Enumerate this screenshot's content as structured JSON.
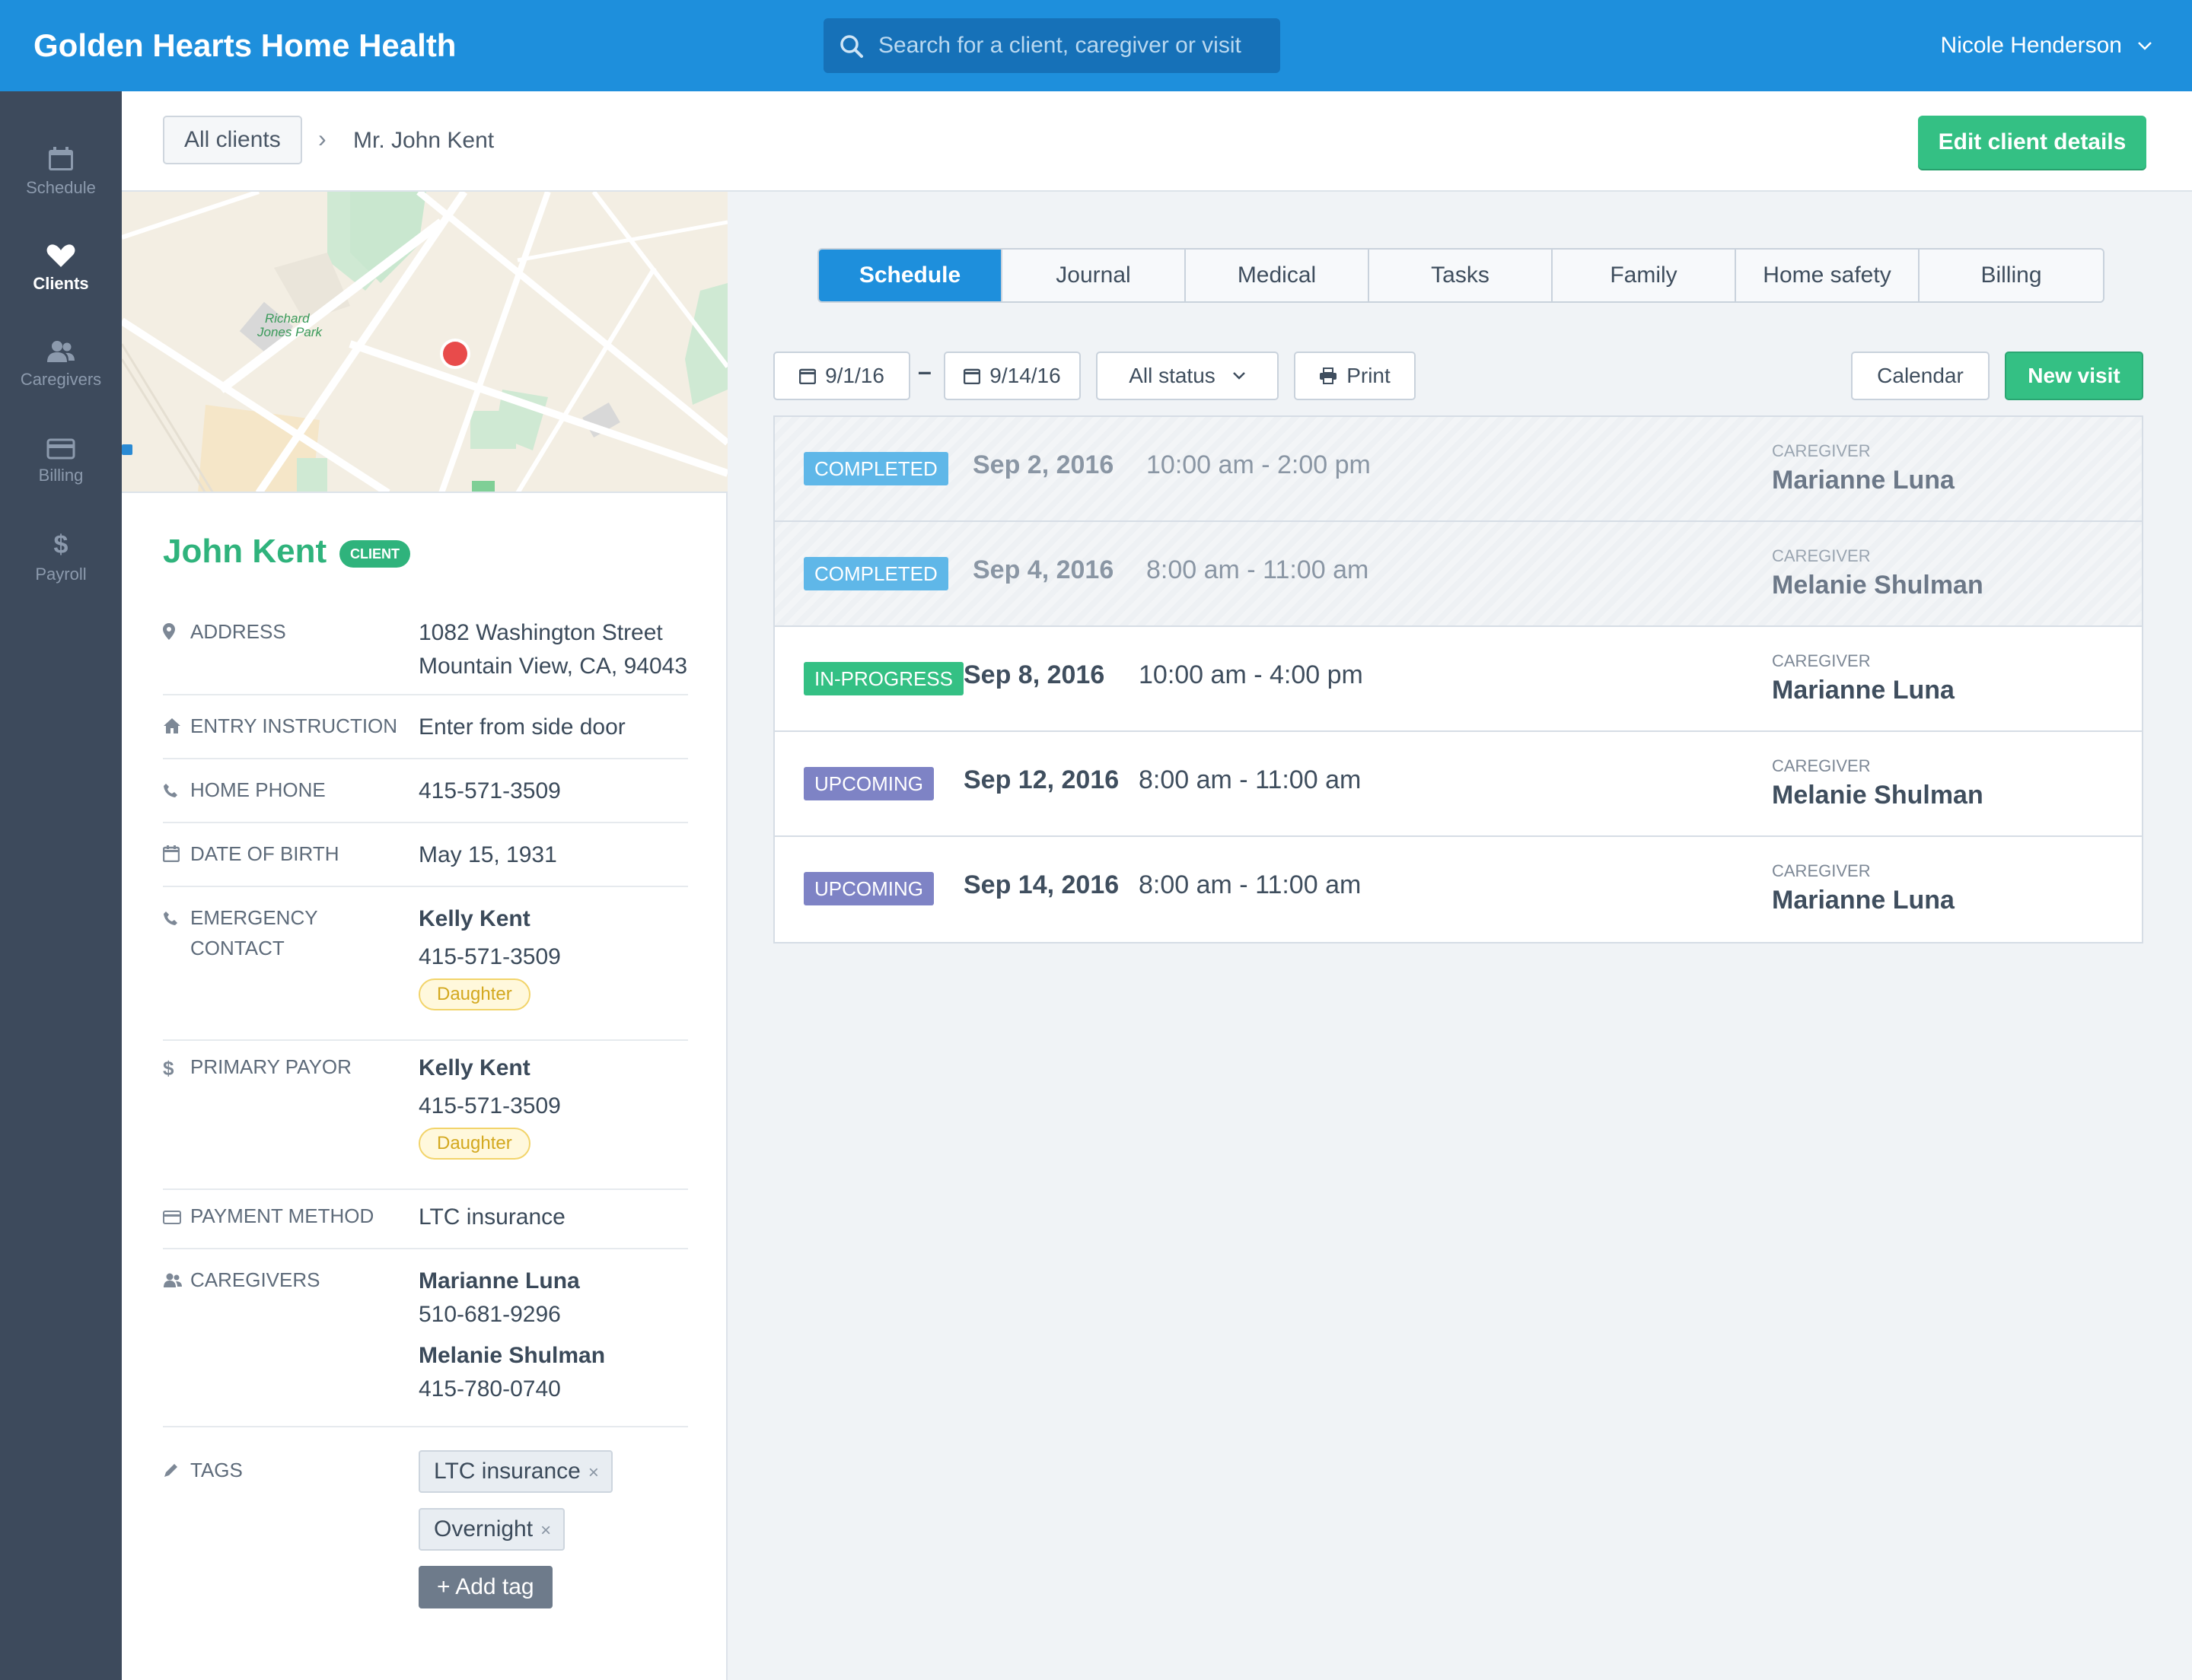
{
  "app": {
    "title": "Golden Hearts Home Health",
    "user_name": "Nicole Henderson"
  },
  "search": {
    "placeholder": "Search for a client, caregiver or visit"
  },
  "nav": {
    "items": [
      {
        "label": "Schedule",
        "icon": "calendar-icon"
      },
      {
        "label": "Clients",
        "icon": "heart-icon"
      },
      {
        "label": "Caregivers",
        "icon": "people-icon"
      },
      {
        "label": "Billing",
        "icon": "credit-card-icon"
      },
      {
        "label": "Payroll",
        "icon": "dollar-icon"
      }
    ]
  },
  "breadcrumb": {
    "all_clients": "All clients",
    "current": "Mr. John Kent"
  },
  "header": {
    "edit_label": "Edit client details"
  },
  "map": {
    "park_label_1": "Richard",
    "park_label_2": "Jones Park"
  },
  "client": {
    "name": "John Kent",
    "badge": "CLIENT",
    "address_label": "ADDRESS",
    "address_line1": "1082 Washington Street",
    "address_line2": "Mountain View, CA, 94043",
    "entry_label": "ENTRY INSTRUCTION",
    "entry_value": "Enter from side door",
    "home_phone_label": "HOME PHONE",
    "home_phone": "415-571-3509",
    "dob_label": "DATE OF BIRTH",
    "dob": "May 15, 1931",
    "emergency_label_1": "EMERGENCY",
    "emergency_label_2": "CONTACT",
    "emergency_name": "Kelly Kent",
    "emergency_phone": "415-571-3509",
    "emergency_relation": "Daughter",
    "payor_label": "PRIMARY PAYOR",
    "payor_name": "Kelly Kent",
    "payor_phone": "415-571-3509",
    "payor_relation": "Daughter",
    "payment_label": "PAYMENT METHOD",
    "payment_value": "LTC insurance",
    "caregivers_label": "CAREGIVERS",
    "caregivers": [
      {
        "name": "Marianne Luna",
        "phone": "510-681-9296"
      },
      {
        "name": "Melanie Shulman",
        "phone": "415-780-0740"
      }
    ],
    "tags_label": "TAGS",
    "tags": [
      "LTC insurance",
      "Overnight"
    ],
    "tag_remove": "×",
    "add_tag_label": "+ Add tag"
  },
  "tabs": [
    "Schedule",
    "Journal",
    "Medical",
    "Tasks",
    "Family",
    "Home safety",
    "Billing"
  ],
  "active_tab": "Schedule",
  "toolbar": {
    "date_from": "9/1/16",
    "date_sep": "–",
    "date_to": "9/14/16",
    "status_filter": "All status",
    "print_label": "Print",
    "calendar_label": "Calendar",
    "new_visit_label": "New visit"
  },
  "visits": [
    {
      "status": "COMPLETED",
      "date": "Sep 2, 2016",
      "time": "10:00 am - 2:00 pm",
      "caregiver_label": "CAREGIVER",
      "caregiver": "Marianne Luna"
    },
    {
      "status": "COMPLETED",
      "date": "Sep 4, 2016",
      "time": "8:00 am - 11:00 am",
      "caregiver_label": "CAREGIVER",
      "caregiver": "Melanie Shulman"
    },
    {
      "status": "IN-PROGRESS",
      "date": "Sep 8, 2016",
      "time": "10:00 am - 4:00 pm",
      "caregiver_label": "CAREGIVER",
      "caregiver": "Marianne Luna"
    },
    {
      "status": "UPCOMING",
      "date": "Sep 12, 2016",
      "time": "8:00 am - 11:00 am",
      "caregiver_label": "CAREGIVER",
      "caregiver": "Melanie Shulman"
    },
    {
      "status": "UPCOMING",
      "date": "Sep 14, 2016",
      "time": "8:00 am - 11:00 am",
      "caregiver_label": "CAREGIVER",
      "caregiver": "Marianne Luna"
    }
  ],
  "colors": {
    "brand_blue": "#1e8fdc",
    "green": "#34c084",
    "completed": "#5fb7e8",
    "upcoming": "#7e83c5",
    "nav_bg": "#3d4a5c"
  }
}
